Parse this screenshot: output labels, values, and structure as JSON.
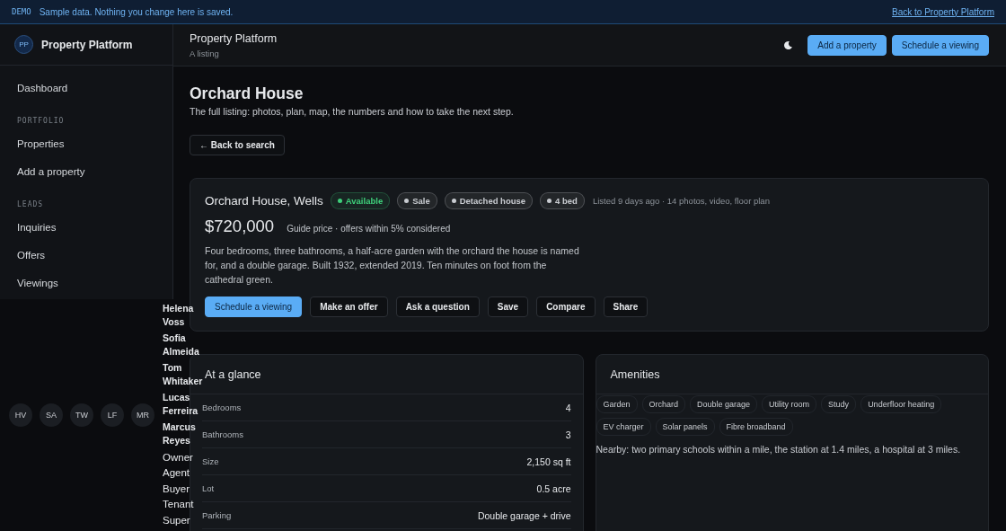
{
  "banner": {
    "tag": "DEMO",
    "message": "Sample data. Nothing you change here is saved.",
    "link": "Back to Property Platform"
  },
  "sidebar": {
    "brand": {
      "initials": "PP",
      "name": "Property Platform"
    },
    "sections": [
      {
        "items": [
          {
            "label": "Dashboard"
          }
        ]
      },
      {
        "heading": "PORTFOLIO",
        "items": [
          {
            "label": "Properties"
          },
          {
            "label": "Add a property"
          }
        ]
      },
      {
        "heading": "LEADS",
        "items": [
          {
            "label": "Inquiries"
          },
          {
            "label": "Offers"
          },
          {
            "label": "Viewings"
          }
        ]
      }
    ]
  },
  "people": {
    "avatars": [
      "HV",
      "SA",
      "TW",
      "LF",
      "MR"
    ],
    "names": [
      "Helena Voss",
      "Sofia Almeida",
      "Tom Whitaker",
      "Lucas Ferreira",
      "Marcus Reyes"
    ],
    "roles": [
      "Owner",
      "Agent",
      "Buyer",
      "Tenant",
      "Super"
    ]
  },
  "header": {
    "title": "Property Platform",
    "subtitle": "A listing",
    "buttons": [
      {
        "label": "Add a property",
        "kind": "primary"
      },
      {
        "label": "Schedule a viewing",
        "kind": "primary"
      }
    ]
  },
  "page": {
    "title": "Orchard House",
    "subtitle": "The full listing: photos, plan, map, the numbers and how to take the next step.",
    "back_button": "← Back to search"
  },
  "listing": {
    "title": "Orchard House, Wells",
    "chips": [
      {
        "label": "Available",
        "color": "#3ecf7a"
      },
      {
        "label": "Sale",
        "color": "#c9ccd1"
      },
      {
        "label": "Detached house",
        "color": "#c9ccd1"
      },
      {
        "label": "4 bed",
        "color": "#c9ccd1"
      }
    ],
    "meta": "Listed 9 days ago · 14 photos, video, floor plan",
    "price": "$720,000",
    "price_note": "Guide price · offers within 5% considered",
    "description": "Four bedrooms, three bathrooms, a half-acre garden with the orchard the house is named for, and a double garage. Built 1932, extended 2019. Ten minutes on foot from the cathedral green.",
    "actions": [
      {
        "label": "Schedule a viewing",
        "kind": "primary"
      },
      {
        "label": "Make an offer",
        "kind": "secondary"
      },
      {
        "label": "Ask a question",
        "kind": "secondary"
      },
      {
        "label": "Save",
        "kind": "secondary"
      },
      {
        "label": "Compare",
        "kind": "secondary"
      },
      {
        "label": "Share",
        "kind": "secondary"
      }
    ]
  },
  "glance": {
    "title": "At a glance",
    "rows": [
      {
        "label": "Bedrooms",
        "value": "4"
      },
      {
        "label": "Bathrooms",
        "value": "3"
      },
      {
        "label": "Size",
        "value": "2,150 sq ft"
      },
      {
        "label": "Lot",
        "value": "0.5 acre"
      },
      {
        "label": "Parking",
        "value": "Double garage + drive"
      }
    ]
  },
  "amenities": {
    "title": "Amenities",
    "tags": [
      "Garden",
      "Orchard",
      "Double garage",
      "Utility room",
      "Study",
      "Underfloor heating",
      "EV charger",
      "Solar panels",
      "Fibre broadband"
    ],
    "nearby": "Nearby: two primary schools within a mile, the station at 1.4 miles, a hospital at 3 miles."
  }
}
